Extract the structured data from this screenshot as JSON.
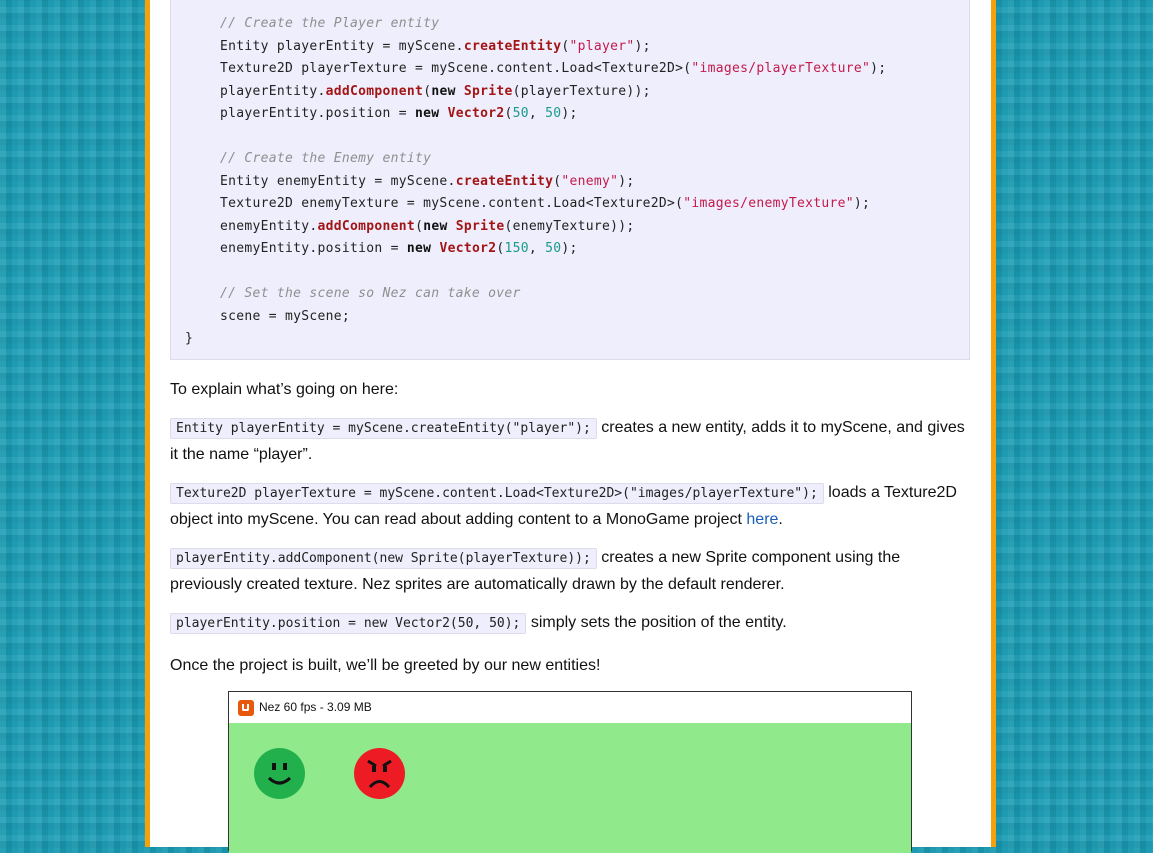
{
  "code": {
    "lines": [
      {
        "indent": "",
        "parts": [
          {
            "t": "// Create the Player entity",
            "c": "cm"
          }
        ]
      },
      {
        "indent": "",
        "parts": [
          {
            "t": "Entity playerEntity = myScene.",
            "c": ""
          },
          {
            "t": "createEntity",
            "c": "fn"
          },
          {
            "t": "(",
            "c": ""
          },
          {
            "t": "\"player\"",
            "c": "str"
          },
          {
            "t": ");",
            "c": ""
          }
        ]
      },
      {
        "indent": "",
        "parts": [
          {
            "t": "Texture2D playerTexture = myScene.content.Load<Texture2D>(",
            "c": ""
          },
          {
            "t": "\"images/playerTexture\"",
            "c": "str"
          },
          {
            "t": ");",
            "c": ""
          }
        ]
      },
      {
        "indent": "",
        "parts": [
          {
            "t": "playerEntity.",
            "c": ""
          },
          {
            "t": "addComponent",
            "c": "fn"
          },
          {
            "t": "(",
            "c": ""
          },
          {
            "t": "new",
            "c": "kw"
          },
          {
            "t": " ",
            "c": ""
          },
          {
            "t": "Sprite",
            "c": "fn"
          },
          {
            "t": "(playerTexture));",
            "c": ""
          }
        ]
      },
      {
        "indent": "",
        "parts": [
          {
            "t": "playerEntity.position = ",
            "c": ""
          },
          {
            "t": "new",
            "c": "kw"
          },
          {
            "t": " ",
            "c": ""
          },
          {
            "t": "Vector2",
            "c": "fn"
          },
          {
            "t": "(",
            "c": ""
          },
          {
            "t": "50",
            "c": "num"
          },
          {
            "t": ", ",
            "c": ""
          },
          {
            "t": "50",
            "c": "num"
          },
          {
            "t": ");",
            "c": ""
          }
        ]
      },
      {
        "indent": "",
        "parts": [
          {
            "t": "// Create the Enemy entity",
            "c": "cm"
          }
        ]
      },
      {
        "indent": "",
        "parts": [
          {
            "t": "Entity enemyEntity = myScene.",
            "c": ""
          },
          {
            "t": "createEntity",
            "c": "fn"
          },
          {
            "t": "(",
            "c": ""
          },
          {
            "t": "\"enemy\"",
            "c": "str"
          },
          {
            "t": ");",
            "c": ""
          }
        ]
      },
      {
        "indent": "",
        "parts": [
          {
            "t": "Texture2D enemyTexture = myScene.content.Load<Texture2D>(",
            "c": ""
          },
          {
            "t": "\"images/enemyTexture\"",
            "c": "str"
          },
          {
            "t": ");",
            "c": ""
          }
        ]
      },
      {
        "indent": "",
        "parts": [
          {
            "t": "enemyEntity.",
            "c": ""
          },
          {
            "t": "addComponent",
            "c": "fn"
          },
          {
            "t": "(",
            "c": ""
          },
          {
            "t": "new",
            "c": "kw"
          },
          {
            "t": " ",
            "c": ""
          },
          {
            "t": "Sprite",
            "c": "fn"
          },
          {
            "t": "(enemyTexture));",
            "c": ""
          }
        ]
      },
      {
        "indent": "",
        "parts": [
          {
            "t": "enemyEntity.position = ",
            "c": ""
          },
          {
            "t": "new",
            "c": "kw"
          },
          {
            "t": " ",
            "c": ""
          },
          {
            "t": "Vector2",
            "c": "fn"
          },
          {
            "t": "(",
            "c": ""
          },
          {
            "t": "150",
            "c": "num"
          },
          {
            "t": ", ",
            "c": ""
          },
          {
            "t": "50",
            "c": "num"
          },
          {
            "t": ");",
            "c": ""
          }
        ]
      },
      {
        "indent": "",
        "parts": [
          {
            "t": "// Set the scene so Nez can take over",
            "c": "cm"
          }
        ]
      },
      {
        "indent": "",
        "parts": [
          {
            "t": "scene = myScene;",
            "c": ""
          }
        ]
      },
      {
        "indent": "",
        "parts": [
          {
            "t": "}",
            "c": ""
          }
        ]
      }
    ]
  },
  "explain_intro": "To explain what’s going on here:",
  "p1": {
    "code": "Entity playerEntity = myScene.createEntity(\"player\");",
    "text": " creates a new entity, adds it to myScene, and gives it the name “player”."
  },
  "p2": {
    "code": "Texture2D playerTexture = myScene.content.Load<Texture2D>(\"images/playerTexture\");",
    "text_before_link": " loads a Texture2D object into myScene. You can read about adding content to a MonoGame project ",
    "link": "here",
    "text_after_link": "."
  },
  "p3": {
    "code": "playerEntity.addComponent(new Sprite(playerTexture));",
    "text": " creates a new Sprite component using the previously created texture. Nez sprites are automatically drawn by the default renderer."
  },
  "p4": {
    "code": "playerEntity.position = new Vector2(50, 50);",
    "text": " simply sets the position of the entity."
  },
  "outro": "Once the project is built, we’ll be greeted by our new entities!",
  "game_window": {
    "title": "Nez 60 fps - 3.09 MB",
    "icon": "monogame-icon",
    "background": "#90ea8c",
    "player_face": {
      "icon": "happy-face-icon",
      "color": "#22b04c"
    },
    "enemy_face": {
      "icon": "angry-face-icon",
      "color": "#ed1c24"
    }
  }
}
